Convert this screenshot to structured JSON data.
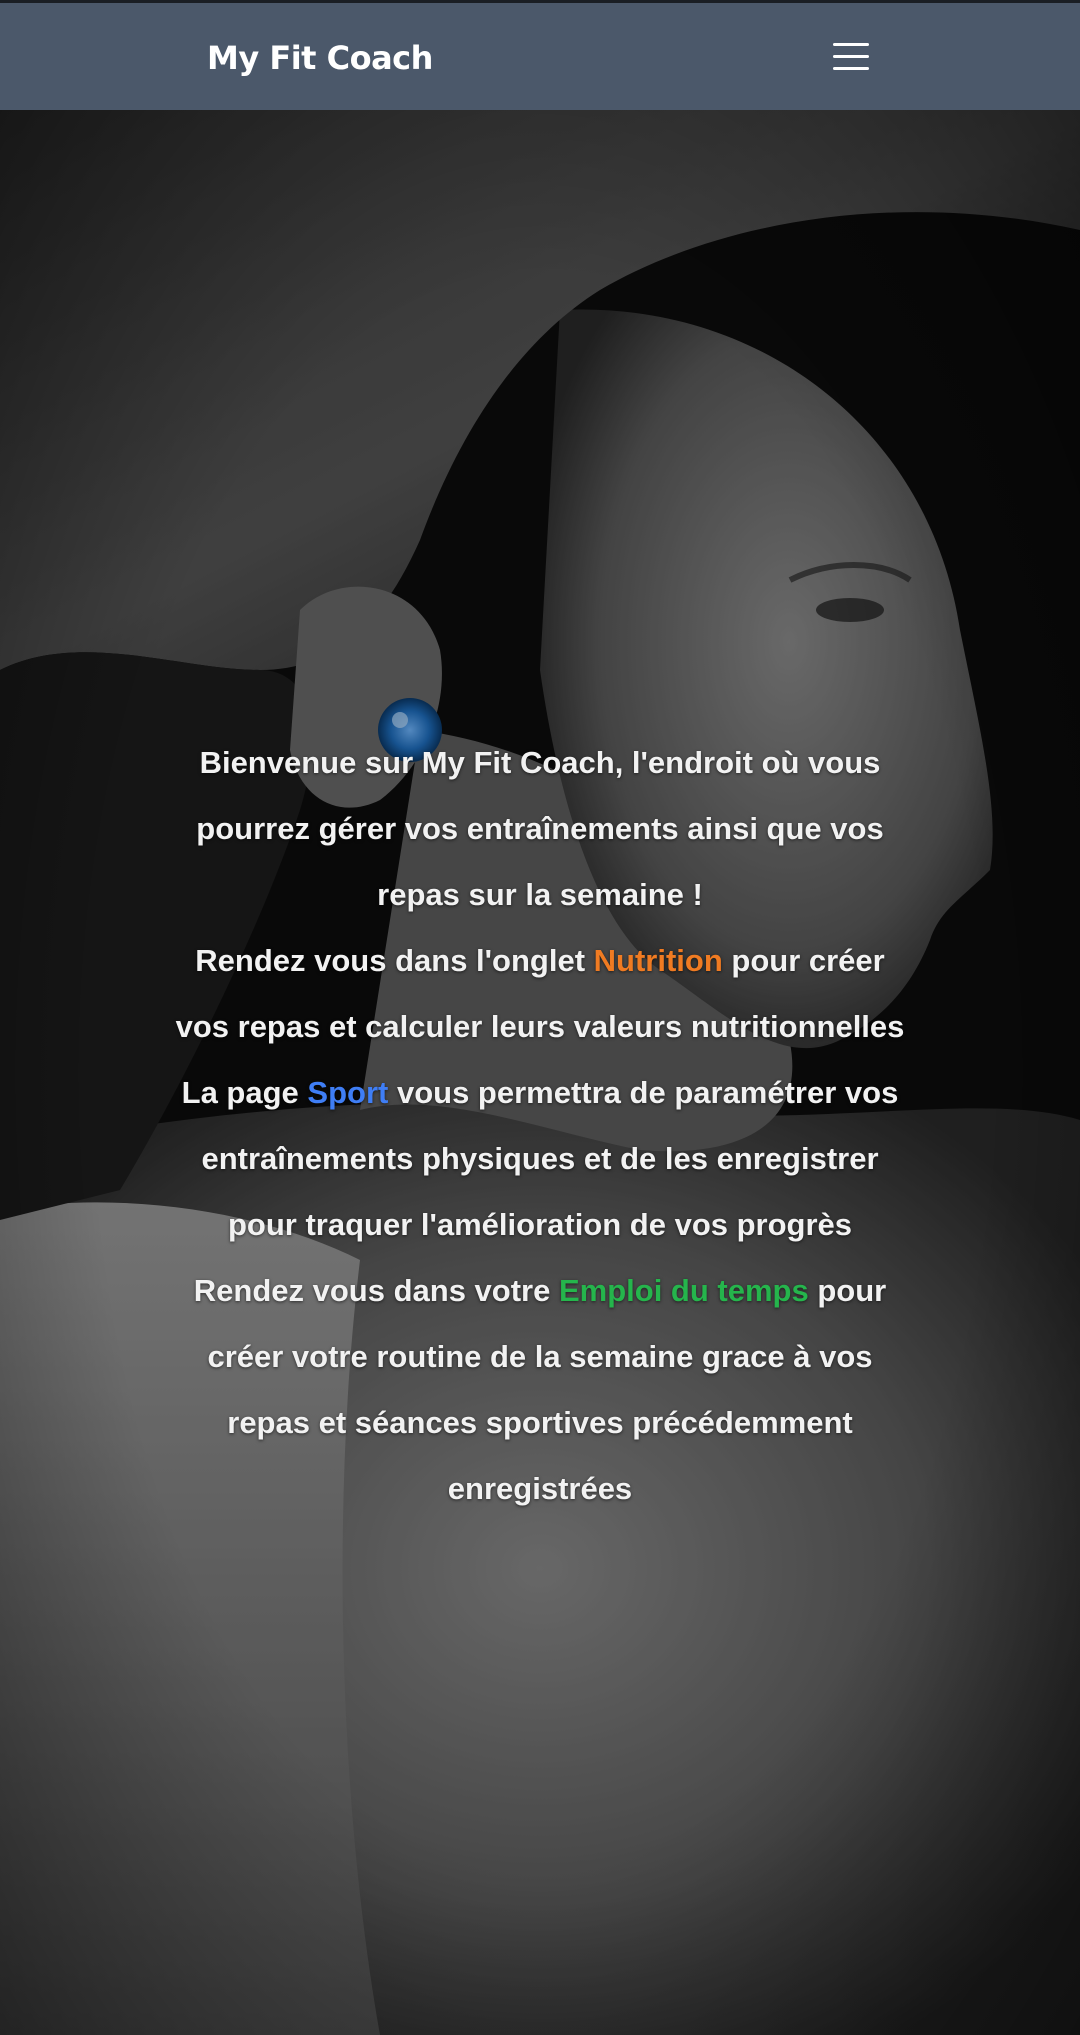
{
  "navbar": {
    "brand": "My Fit Coach",
    "menu_icon": "hamburger-menu-icon"
  },
  "hero": {
    "background": "grayscale photo of a woman athlete in profile wearing a blue earphone",
    "paragraphs": [
      {
        "text": "Bienvenue sur My Fit Coach, l'endroit où vous pourrez gérer vos entraînements ainsi que vos repas sur la semaine !"
      },
      {
        "before": "Rendez vous dans l'onglet ",
        "link": "Nutrition",
        "after": " pour créer vos repas et calculer leurs valeurs nutritionnelles"
      },
      {
        "before": "La page ",
        "link": "Sport",
        "after": " vous permettra de paramétrer vos entraînements physiques et de les enregistrer pour traquer l'amélioration de vos progrès"
      },
      {
        "before": "Rendez vous dans votre ",
        "link": "Emploi du temps",
        "after": " pour créer votre routine de la semaine grace à vos repas et séances sportives précédemment enregistrées"
      }
    ]
  },
  "colors": {
    "navbar": "#4b586a",
    "nutrition": "#f07b22",
    "sport": "#3f7ef5",
    "emploi": "#25b54c"
  }
}
